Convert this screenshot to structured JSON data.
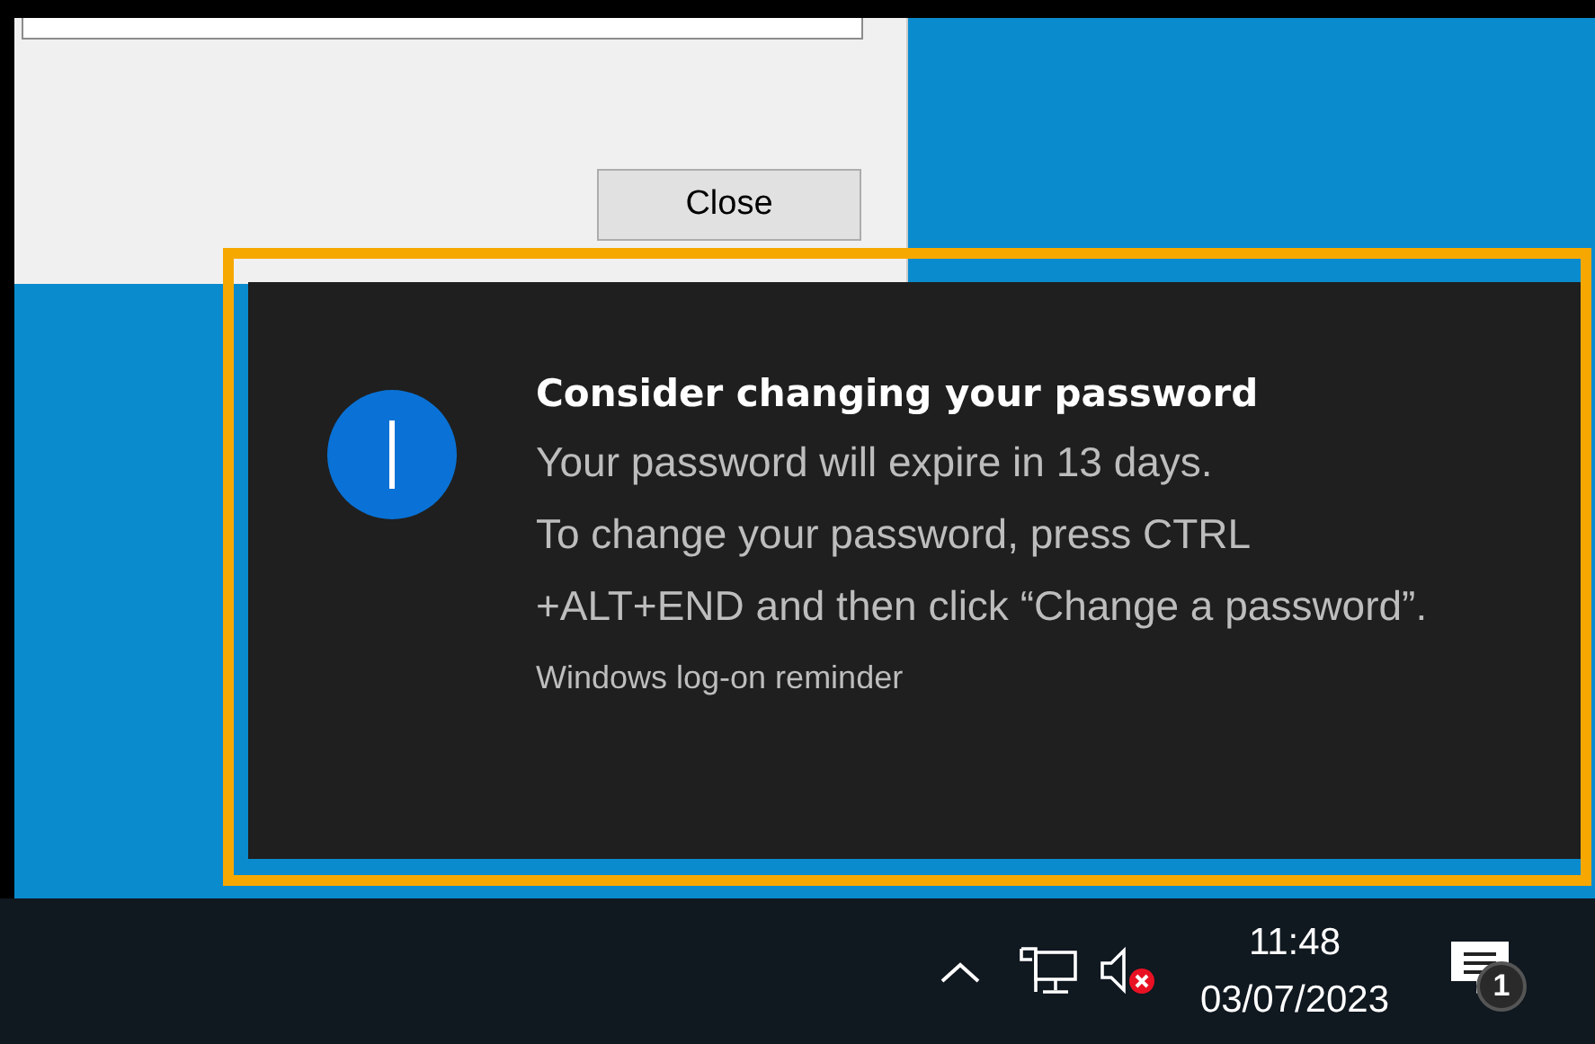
{
  "dialog": {
    "buttons": [
      "Close"
    ]
  },
  "toast": {
    "highlighted": true,
    "title": "Consider changing your password",
    "lines": [
      "Your password will expire in 13 days.",
      "To change your password, press CTRL +ALT+END and then click “Change a password”."
    ],
    "attribution": "Windows log-on reminder"
  },
  "taskbar": {
    "volume_muted": true,
    "clock": {
      "time": "11:48",
      "date": "03/07/2023"
    },
    "notification_count": "1"
  }
}
